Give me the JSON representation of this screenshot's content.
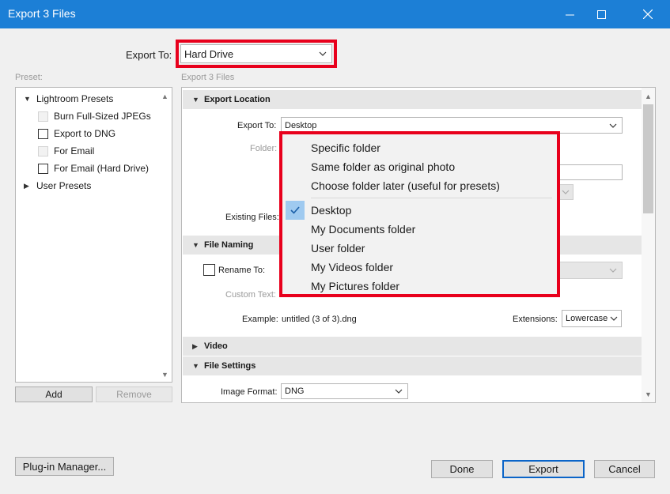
{
  "window": {
    "title": "Export 3 Files"
  },
  "export_to": {
    "label": "Export To:",
    "value": "Hard Drive"
  },
  "preset": {
    "label": "Preset:",
    "groups": [
      {
        "name": "Lightroom Presets",
        "items": [
          "Burn Full-Sized JPEGs",
          "Export to DNG",
          "For Email",
          "For Email (Hard Drive)"
        ]
      },
      {
        "name": "User Presets"
      }
    ],
    "add_label": "Add",
    "remove_label": "Remove"
  },
  "main": {
    "header": "Export 3 Files",
    "export_location": {
      "title": "Export Location",
      "export_to_label": "Export To:",
      "export_to_value": "Desktop",
      "folder_label": "Folder:",
      "existing_files_label": "Existing Files:"
    },
    "file_naming": {
      "title": "File Naming",
      "rename_label": "Rename To:",
      "custom_text_label": "Custom Text:",
      "example_label": "Example:",
      "example_value": "untitled (3 of 3).dng",
      "extensions_label": "Extensions:",
      "extensions_value": "Lowercase"
    },
    "video": {
      "title": "Video"
    },
    "file_settings": {
      "title": "File Settings",
      "image_format_label": "Image Format:",
      "image_format_value": "DNG"
    }
  },
  "dropdown_menu": {
    "group1": [
      "Specific folder",
      "Same folder as original photo",
      "Choose folder later (useful for presets)"
    ],
    "group2": [
      "Desktop",
      "My Documents folder",
      "User folder",
      "My Videos folder",
      "My Pictures folder"
    ],
    "selected": "Desktop"
  },
  "footer": {
    "plugin_manager": "Plug-in Manager...",
    "done": "Done",
    "export": "Export",
    "cancel": "Cancel"
  },
  "colors": {
    "titlebar": "#1c7fd6",
    "highlight": "#e8001c",
    "selection": "#9fcaf0"
  }
}
